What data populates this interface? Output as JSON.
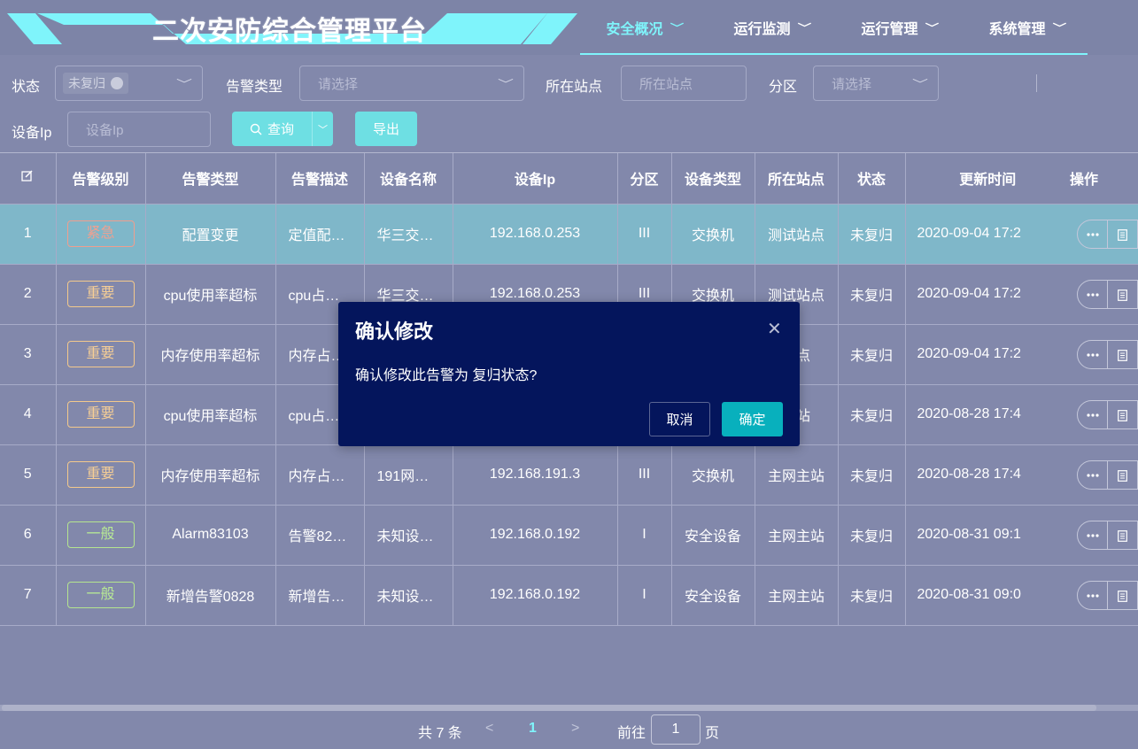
{
  "app": {
    "title": "二次安防综合管理平台"
  },
  "nav": [
    {
      "label": "安全概况",
      "active": true
    },
    {
      "label": "运行监测",
      "active": false
    },
    {
      "label": "运行管理",
      "active": false
    },
    {
      "label": "系统管理",
      "active": false
    }
  ],
  "filters": {
    "status_label": "状态",
    "status_tag": "未复归",
    "alarm_type_label": "告警类型",
    "alarm_type_placeholder": "请选择",
    "station_label": "所在站点",
    "station_placeholder": "所在站点",
    "zone_label": "分区",
    "zone_placeholder": "请选择",
    "ip_label": "设备Ip",
    "ip_placeholder": "设备Ip",
    "query_label": "查询",
    "export_label": "导出"
  },
  "table": {
    "headers": [
      "告警级别",
      "告警类型",
      "告警描述",
      "设备名称",
      "设备Ip",
      "分区",
      "设备类型",
      "所在站点",
      "状态",
      "更新时间",
      "操作"
    ],
    "rows": [
      {
        "no": "1",
        "level": "紧急",
        "level_kind": "red",
        "type": "配置变更",
        "desc": "定值配…",
        "device": "华三交…",
        "ip": "192.168.0.253",
        "zone": "III",
        "device_type": "交换机",
        "station": "测试站点",
        "status": "未复归",
        "time": "2020-09-04 17:2"
      },
      {
        "no": "2",
        "level": "重要",
        "level_kind": "orange",
        "type": "cpu使用率超标",
        "desc": "cpu占…",
        "device": "华三交…",
        "ip": "192.168.0.253",
        "zone": "III",
        "device_type": "交换机",
        "station": "测试站点",
        "status": "未复归",
        "time": "2020-09-04 17:2"
      },
      {
        "no": "3",
        "level": "重要",
        "level_kind": "orange",
        "type": "内存使用率超标",
        "desc": "内存占…",
        "device": "",
        "ip": "",
        "zone": "",
        "device_type": "",
        "station": "站点",
        "status": "未复归",
        "time": "2020-09-04 17:2"
      },
      {
        "no": "4",
        "level": "重要",
        "level_kind": "orange",
        "type": "cpu使用率超标",
        "desc": "cpu占…",
        "device": "",
        "ip": "",
        "zone": "",
        "device_type": "",
        "station": "主站",
        "status": "未复归",
        "time": "2020-08-28 17:4"
      },
      {
        "no": "5",
        "level": "重要",
        "level_kind": "orange",
        "type": "内存使用率超标",
        "desc": "内存占…",
        "device": "191网…",
        "ip": "192.168.191.3",
        "zone": "III",
        "device_type": "交换机",
        "station": "主网主站",
        "status": "未复归",
        "time": "2020-08-28 17:4"
      },
      {
        "no": "6",
        "level": "一般",
        "level_kind": "green",
        "type": "Alarm83103",
        "desc": "告警82…",
        "device": "未知设…",
        "ip": "192.168.0.192",
        "zone": "I",
        "device_type": "安全设备",
        "station": "主网主站",
        "status": "未复归",
        "time": "2020-08-31 09:1"
      },
      {
        "no": "7",
        "level": "一般",
        "level_kind": "green",
        "type": "新增告警0828",
        "desc": "新增告…",
        "device": "未知设…",
        "ip": "192.168.0.192",
        "zone": "I",
        "device_type": "安全设备",
        "station": "主网主站",
        "status": "未复归",
        "time": "2020-08-31 09:0"
      }
    ]
  },
  "pagination": {
    "total_text": "共 7 条",
    "current_page": "1",
    "goto_label": "前往",
    "goto_value": "1",
    "page_unit": "页"
  },
  "modal": {
    "title": "确认修改",
    "message": "确认修改此告警为 复归状态?",
    "cancel_label": "取消",
    "confirm_label": "确定"
  },
  "colors": {
    "accent": "#7ff4fb",
    "background": "#8288ab",
    "modal_bg": "#04155c",
    "confirm_button": "#08b0bd",
    "highlight_row": "#7fb7c9"
  }
}
